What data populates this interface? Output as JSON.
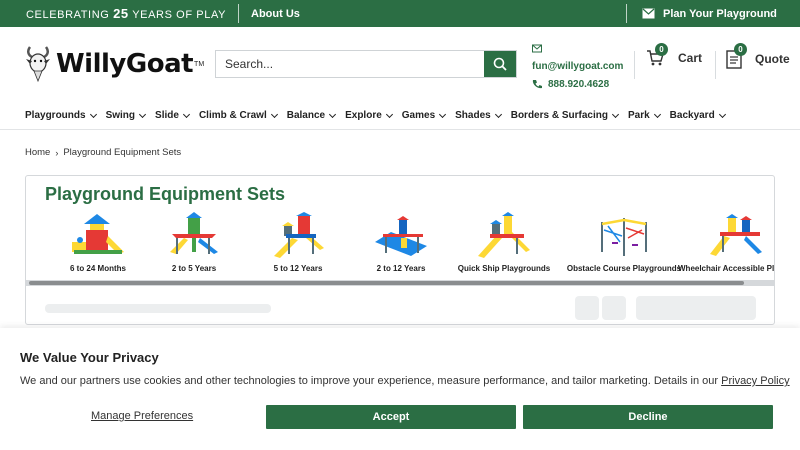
{
  "topbar": {
    "celebrating_prefix": "CELEBRATING",
    "celebrating_number": "25",
    "celebrating_suffix": "YEARS OF PLAY",
    "about": "About Us",
    "plan": "Plan Your Playground"
  },
  "brand": {
    "name": "WillyGoat",
    "tm": "TM"
  },
  "search": {
    "placeholder": "Search..."
  },
  "contact": {
    "email": "fun@willygoat.com",
    "phone": "888.920.4628"
  },
  "cart": {
    "label": "Cart",
    "count": "0"
  },
  "quote": {
    "label": "Quote",
    "count": "0"
  },
  "nav": {
    "items": [
      {
        "label": "Playgrounds"
      },
      {
        "label": "Swing"
      },
      {
        "label": "Slide"
      },
      {
        "label": "Climb & Crawl"
      },
      {
        "label": "Balance"
      },
      {
        "label": "Explore"
      },
      {
        "label": "Games"
      },
      {
        "label": "Shades"
      },
      {
        "label": "Borders & Surfacing"
      },
      {
        "label": "Park"
      },
      {
        "label": "Backyard"
      }
    ]
  },
  "breadcrumb": {
    "home": "Home",
    "current": "Playground Equipment Sets"
  },
  "category": {
    "title": "Playground Equipment Sets",
    "items": [
      {
        "label": "6 to 24 Months"
      },
      {
        "label": "2 to 5 Years"
      },
      {
        "label": "5 to 12 Years"
      },
      {
        "label": "2 to 12 Years"
      },
      {
        "label": "Quick Ship Playgrounds"
      },
      {
        "label": "Obstacle Course Playgrounds"
      },
      {
        "label": "Wheelchair Accessible Playgr"
      }
    ]
  },
  "privacy": {
    "title": "We Value Your Privacy",
    "text": "We and our partners use cookies and other technologies to improve your experience, measure performance, and tailor marketing. Details in our",
    "link": "Privacy Policy",
    "manage": "Manage Preferences",
    "accept": "Accept",
    "decline": "Decline"
  },
  "colors": {
    "brand_green": "#2b6e44"
  }
}
